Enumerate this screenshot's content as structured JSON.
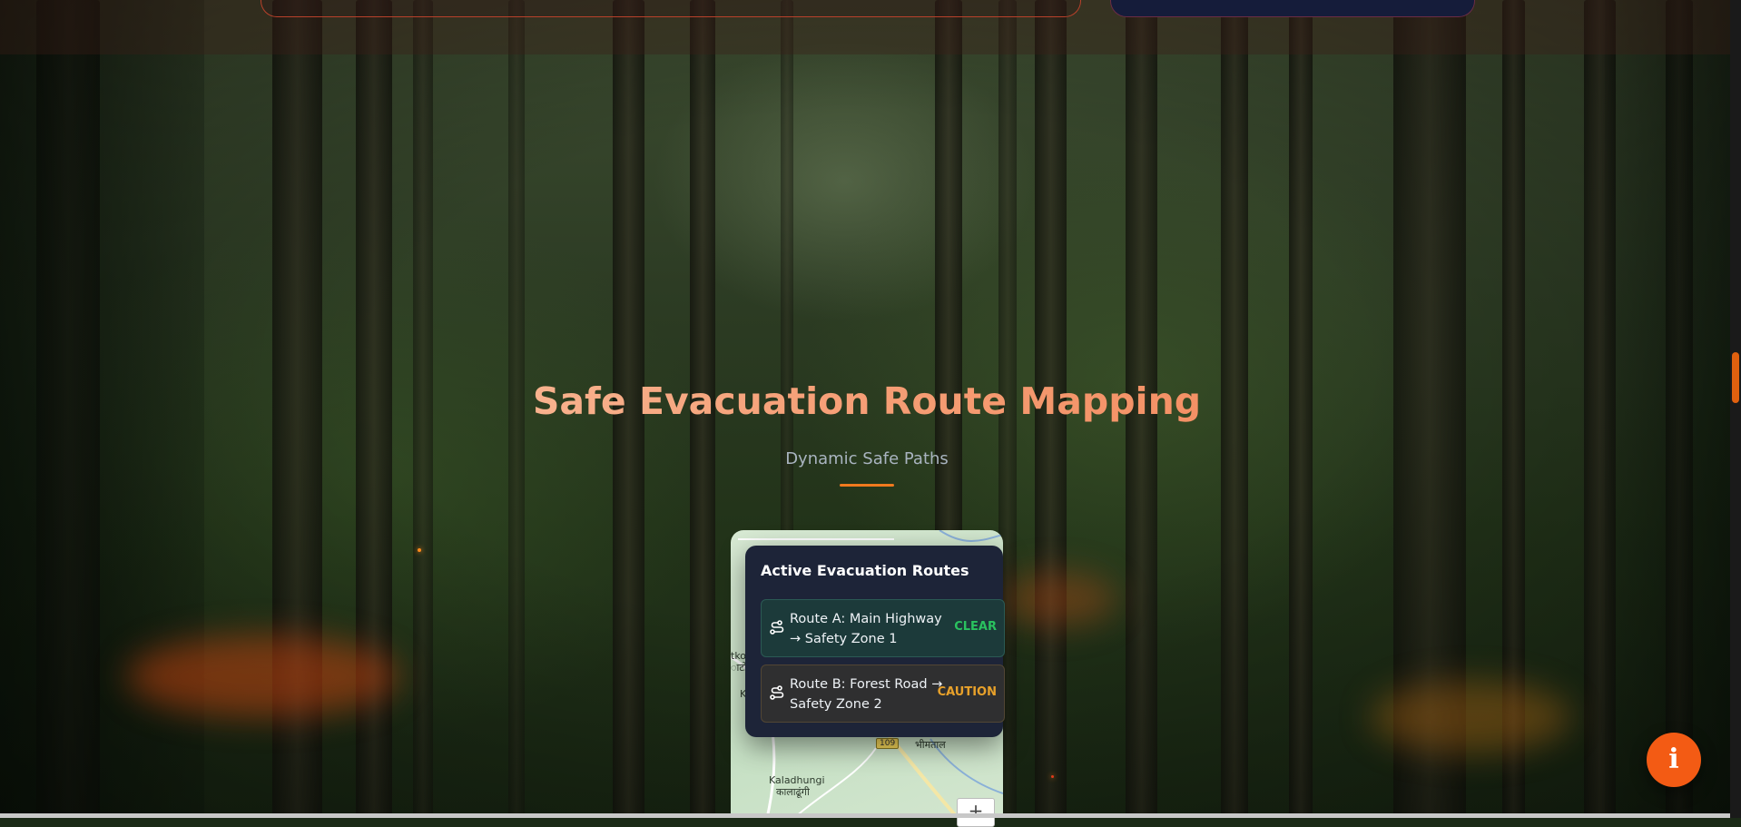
{
  "section": {
    "title": "Safe Evacuation Route Mapping",
    "subtitle": "Dynamic Safe Paths"
  },
  "routes_panel": {
    "title": "Active Evacuation Routes",
    "routes": [
      {
        "label": "Route A: Main Highway → Safety Zone 1",
        "status": "CLEAR",
        "icon": "route-icon"
      },
      {
        "label": "Route B: Forest Road → Safety Zone 2",
        "status": "CAUTION",
        "icon": "route-icon"
      }
    ]
  },
  "map": {
    "labels": [
      "Kaladhungi",
      "कालाढूंगी",
      "भीमताल",
      "tko",
      "ाटो",
      "K"
    ],
    "road_shield": "109",
    "zoom_in": "+"
  },
  "info_button": {
    "label": "i",
    "icon": "info-icon"
  },
  "colors": {
    "accent": "#f35b14",
    "clear": "#2ac25f",
    "caution": "#e8a12a",
    "panel": "#1d2438"
  }
}
